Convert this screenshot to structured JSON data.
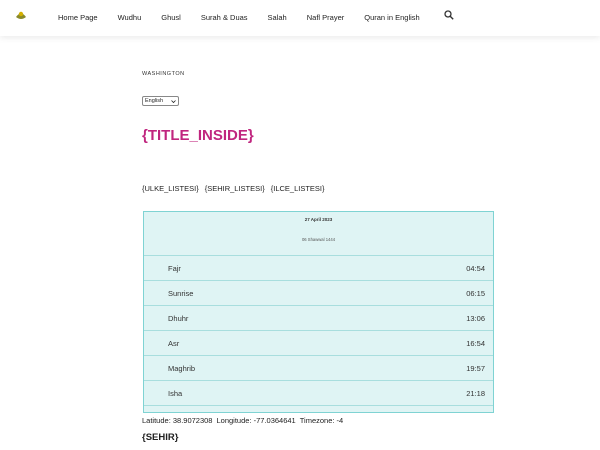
{
  "nav": {
    "items": [
      "Home Page",
      "Wudhu",
      "Ghusl",
      "Surah & Duas",
      "Salah",
      "Nafl Prayer",
      "Quran in English"
    ]
  },
  "location": "WASHINGTON",
  "language": {
    "selected": "English"
  },
  "title": "{TITLE_INSIDE}",
  "lists": [
    "{ULKE_LISTESI}",
    "{SEHIR_LISTESI}",
    "{ILCE_LISTESI}"
  ],
  "card": {
    "gregorian_date": "27 April 2023",
    "hijri_date": "06 Shawwal 1444"
  },
  "prayers": [
    {
      "name": "Fajr",
      "time": "04:54"
    },
    {
      "name": "Sunrise",
      "time": "06:15"
    },
    {
      "name": "Dhuhr",
      "time": "13:06"
    },
    {
      "name": "Asr",
      "time": "16:54"
    },
    {
      "name": "Maghrib",
      "time": "19:57"
    },
    {
      "name": "Isha",
      "time": "21:18"
    }
  ],
  "coords": {
    "latitude": "Latitude: 38.9072308",
    "longitude": "Longitude: -77.0364641",
    "timezone": "Timezone: -4"
  },
  "footer_heading": "{SEHIR}",
  "colors": {
    "title": "#c0267f",
    "card_bg": "#dff4f4",
    "card_border": "#7fd3d3"
  }
}
